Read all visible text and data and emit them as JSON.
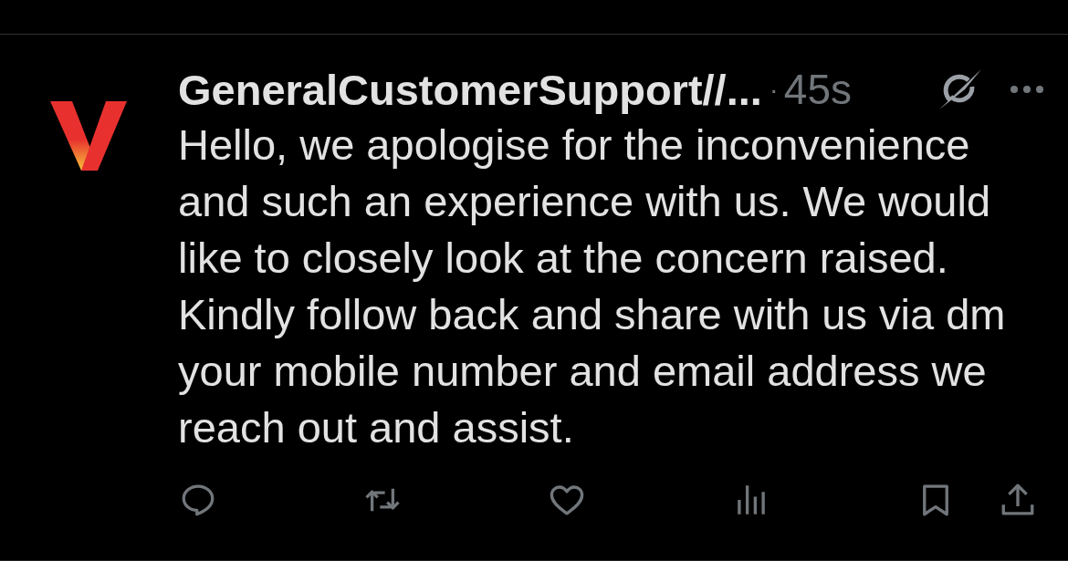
{
  "post": {
    "author": "GeneralCustomerSupport//...",
    "separator": "·",
    "time": "45s",
    "text": "Hello, we apologise for the inconvenience and such an experience with us. We would like to closely look at the concern raised. Kindly follow back and share with us via dm your mobile number and email address we reach out and assist."
  },
  "actions": [
    {
      "kind": "reply"
    },
    {
      "kind": "repost"
    },
    {
      "kind": "like"
    },
    {
      "kind": "views"
    },
    {
      "kind": "bookmark"
    },
    {
      "kind": "share"
    }
  ]
}
